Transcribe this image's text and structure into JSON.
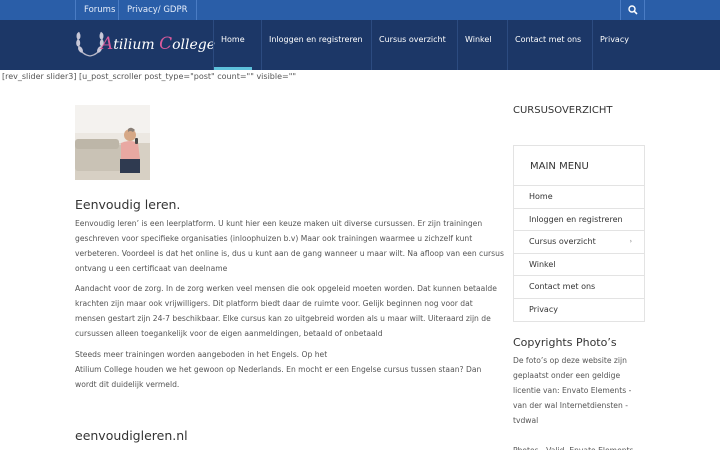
{
  "topbar": {
    "links": [
      "Forums",
      "Privacy/ GDPR"
    ],
    "search_icon": "search-icon"
  },
  "header": {
    "logo_text_a": "A",
    "logo_text_b": "tilium ",
    "logo_text_c": "C",
    "logo_text_d": "ollege",
    "nav": [
      "Home",
      "Inloggen en registreren",
      "Cursus overzicht",
      "Winkel",
      "Contact met ons",
      "Privacy"
    ]
  },
  "shortcode_text": "[rev_slider slider3]  [u_post_scroller post_type=\"post\" count=\"\" visible=\"\"",
  "main": {
    "title": "Eenvoudig leren.",
    "paragraphs": [
      "Eenvoudig leren’ is een leerplatform. U kunt hier een keuze maken uit diverse cursussen. Er zijn trainingen geschreven voor specifieke organisaties (inloophuizen b.v) Maar ook trainingen waarmee u zichzelf  kunt verbeteren. Voordeel is dat het online is, dus u kunt aan de gang wanneer u maar wilt. Na afloop van een cursus ontvang u een certificaat  van deelname",
      "Aandacht voor de zorg. In de zorg werken veel mensen die ook opgeleid moeten worden. Dat kunnen betaalde krachten zijn maar ook vrijwilligers. Dit platform biedt daar de ruimte voor. Gelijk beginnen nog voor dat mensen gestart zijn 24-7 beschikbaar. Elke cursus kan zo uitgebreid worden als u maar wilt. Uiteraard zijn de cursussen alleen toegankelijk voor de eigen aanmeldingen, betaald of onbetaald",
      "Steeds meer trainingen worden aangeboden in het Engels. Op het\nAtilium College houden we het gewoon op Nederlands. En mocht er een Engelse cursus tussen staan? Dan wordt dit duidelijk vermeld."
    ],
    "subtitle": "eenvoudigleren.nl"
  },
  "sidebar": {
    "cursus_heading": "CURSUSOVERZICHT",
    "menu_title": "MAIN MENU",
    "menu_items": [
      "Home",
      "Inloggen en registreren",
      "Cursus overzicht",
      "Winkel",
      "Contact met ons",
      "Privacy"
    ],
    "copyright_title": "Copyrights Photo’s",
    "copyright_text": "De foto’s op deze website zijn geplaatst onder een geldige licentie van: Envato Elements - van der wal Internetdiensten - tvdwal",
    "cutoff_text": "Photos - Valid, Envato Elements"
  }
}
